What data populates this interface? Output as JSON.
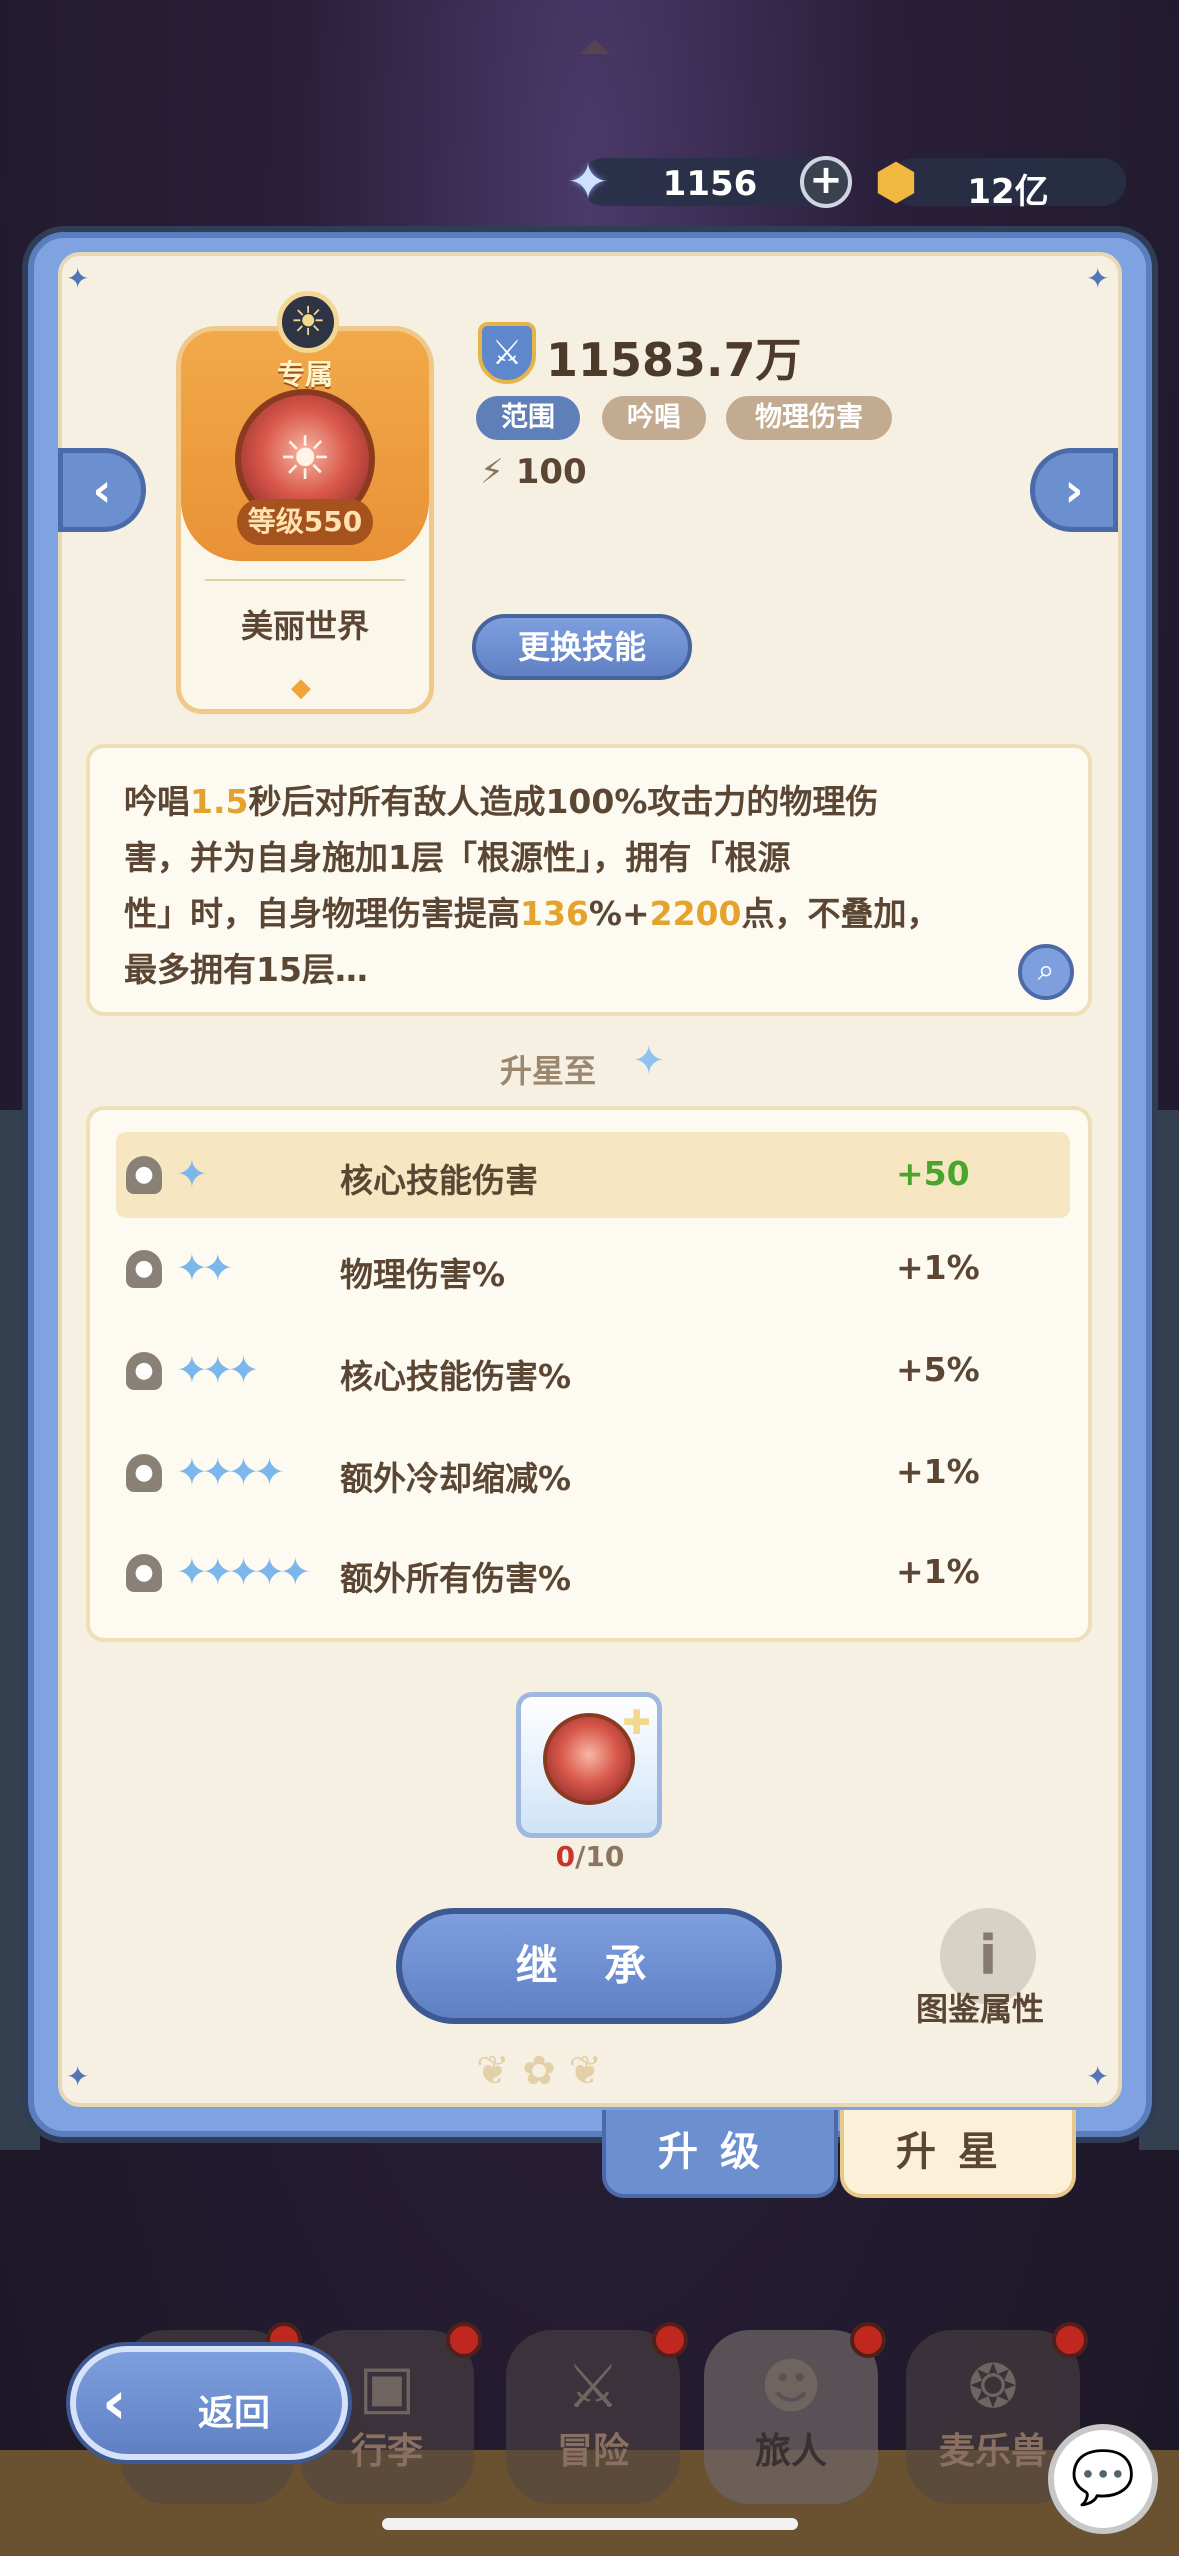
{
  "currency": {
    "stars_value": "1156",
    "stars_icon": "star-crystal-icon",
    "plus_label": "+",
    "gold_value": "12亿",
    "gold_icon": "gold-coin-icon"
  },
  "skill": {
    "exclusive_label": "专属",
    "level_label": "等级550",
    "name": "美丽世界",
    "power": "11583.7万",
    "tags": [
      "范围",
      "吟唱",
      "物理伤害"
    ],
    "energy": "100",
    "change_button": "更换技能"
  },
  "description": {
    "line1_a": "吟唱",
    "line1_hl": "1.5",
    "line1_b": "秒后对所有敌人造成100%攻击力的物理伤",
    "line2": "害，并为自身施加1层「根源性」，拥有「根源",
    "line3_a": "性」时，自身物理伤害提高",
    "line3_hl1": "136",
    "line3_b": "%+",
    "line3_hl2": "2200",
    "line3_c": "点，不叠加，",
    "line4": "最多拥有15层…"
  },
  "upstar": {
    "title": "升星至",
    "rows": [
      {
        "stars": "✦",
        "label": "核心技能伤害",
        "value": "+50"
      },
      {
        "stars": "✦✦",
        "label": "物理伤害%",
        "value": "+1%"
      },
      {
        "stars": "✦✦✦",
        "label": "核心技能伤害%",
        "value": "+5%"
      },
      {
        "stars": "✦✦✦✦",
        "label": "额外冷却缩减%",
        "value": "+1%"
      },
      {
        "stars": "✦✦✦✦✦",
        "label": "额外所有伤害%",
        "value": "+1%"
      }
    ]
  },
  "material": {
    "have": "0",
    "need": "/10"
  },
  "actions": {
    "inherit_button": "继 承",
    "codex_label": "图鉴属性"
  },
  "tabs": {
    "upgrade": "升级",
    "upstar": "升星"
  },
  "bottom_nav": {
    "back_label": "返回",
    "items": [
      "行李",
      "冒险",
      "旅人",
      "麦乐兽"
    ]
  },
  "colors": {
    "accent_blue": "#6c8fd0",
    "highlight_orange": "#e3a32c",
    "bonus_green": "#4aa52e",
    "panel_bg": "#f6f0e2"
  }
}
